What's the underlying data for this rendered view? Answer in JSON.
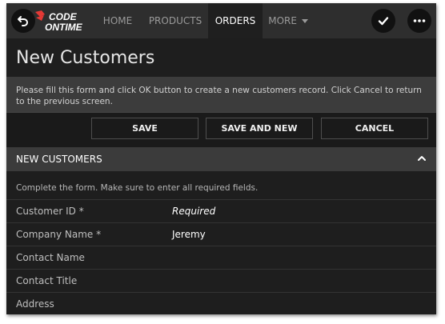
{
  "nav": {
    "logo_top": "CODE",
    "logo_bottom": "ONTIME",
    "menu": [
      {
        "label": "HOME"
      },
      {
        "label": "PRODUCTS"
      },
      {
        "label": "ORDERS"
      },
      {
        "label": "MORE"
      }
    ],
    "active_item": "ORDERS"
  },
  "page": {
    "title": "New Customers",
    "description": "Please fill this form and click OK button to create a new customers record. Click Cancel to return to the previous screen."
  },
  "actions": {
    "save_label": "SAVE",
    "save_and_new_label": "SAVE AND NEW",
    "cancel_label": "CANCEL"
  },
  "section": {
    "title": "NEW CUSTOMERS",
    "description": "Complete the form. Make sure to enter all required fields."
  },
  "fields": [
    {
      "label": "Customer ID *",
      "value": "Required"
    },
    {
      "label": "Company Name *",
      "value": "Jeremy"
    },
    {
      "label": "Contact Name",
      "value": ""
    },
    {
      "label": "Contact Title",
      "value": ""
    },
    {
      "label": "Address",
      "value": ""
    }
  ],
  "colors": {
    "background": "#1e1e1e",
    "navbar": "#2e2e2e",
    "accent": "#e53935"
  }
}
